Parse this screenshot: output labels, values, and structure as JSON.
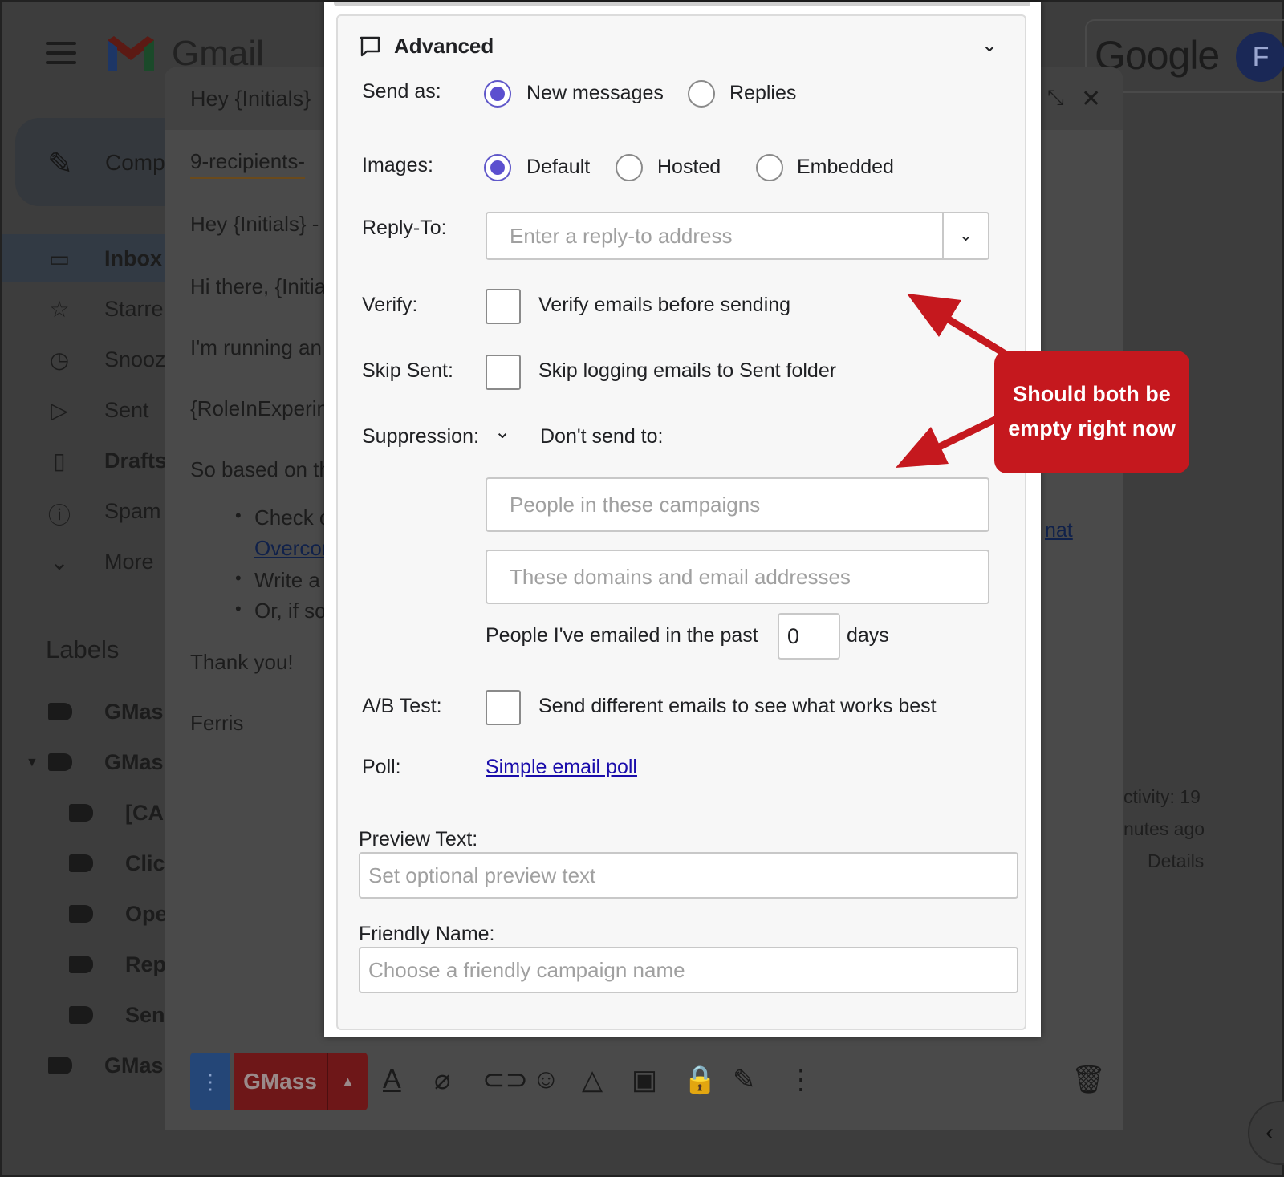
{
  "gmail": {
    "brand": "Gmail",
    "google": "Google",
    "avatar_initial": "F",
    "compose_label": "Comp",
    "nav": [
      {
        "icon": "inbox-icon",
        "label": "Inbox"
      },
      {
        "icon": "star-icon",
        "label": "Starre"
      },
      {
        "icon": "clock-icon",
        "label": "Snooz"
      },
      {
        "icon": "send-icon",
        "label": "Sent"
      },
      {
        "icon": "file-icon",
        "label": "Drafts"
      },
      {
        "icon": "alert-icon",
        "label": "Spam"
      },
      {
        "icon": "chevron-down-icon",
        "label": "More"
      }
    ],
    "labels_title": "Labels",
    "labels": [
      "GMas",
      "GMas",
      "[CA",
      "Clic",
      "Ope",
      "Rep",
      "Sen",
      "GMas"
    ]
  },
  "compose": {
    "title": "Hey {Initials}",
    "to": "9-recipients-",
    "subject": "Hey {Initials} -",
    "body": {
      "greeting": "Hi there, {Initia",
      "line1": "I'm running an",
      "line2": "{RoleInExperin",
      "line3": "So based on th",
      "bullet1": "Check c",
      "bullet1_link": "Overcor",
      "bullet2": "Write a",
      "bullet3": "Or, if so",
      "thanks": "Thank you!",
      "signature": "Ferris"
    },
    "right_link": "nat",
    "activity": "ctivity: 19",
    "minutes": "nutes ago",
    "details": "Details",
    "gmass_button": "GMass",
    "more_dots": "⋮"
  },
  "advanced": {
    "title": "Advanced",
    "send_as": {
      "label": "Send as:",
      "options": [
        "New messages",
        "Replies"
      ],
      "selected": "New messages"
    },
    "images": {
      "label": "Images:",
      "options": [
        "Default",
        "Hosted",
        "Embedded"
      ],
      "selected": "Default"
    },
    "reply_to": {
      "label": "Reply-To:",
      "placeholder": "Enter a reply-to address"
    },
    "verify": {
      "label": "Verify:",
      "text": "Verify emails before sending",
      "checked": false
    },
    "skip_sent": {
      "label": "Skip Sent:",
      "text": "Skip logging emails to Sent folder",
      "checked": false
    },
    "suppression": {
      "label": "Suppression:",
      "dont_send": "Don't send to:",
      "campaigns_placeholder": "People in these campaigns",
      "domains_placeholder": "These domains and email addresses",
      "past_prefix": "People I've emailed in the past",
      "past_value": "0",
      "past_suffix": "days"
    },
    "ab_test": {
      "label": "A/B Test:",
      "text": "Send different emails to see what works best",
      "checked": false
    },
    "poll": {
      "label": "Poll:",
      "link": "Simple email poll"
    },
    "preview_text": {
      "label": "Preview Text:",
      "placeholder": "Set optional preview text"
    },
    "friendly_name": {
      "label": "Friendly Name:",
      "placeholder": "Choose a friendly campaign name"
    }
  },
  "annotation": {
    "line1": "Should both be",
    "line2": "empty right now",
    "color": "#c5181e"
  }
}
